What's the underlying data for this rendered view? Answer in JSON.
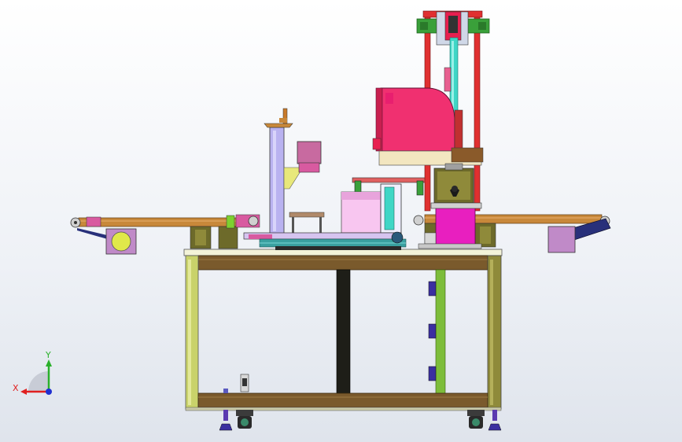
{
  "triad": {
    "x_label": "X",
    "y_label": "Y",
    "x_color": "#e02020",
    "y_color": "#2ab02a",
    "z_color": "#2030d0"
  },
  "palette": {
    "frame_olive": "#c9d26a",
    "frame_dark": "#6d6a2a",
    "wood_beam": "#7a5a2c",
    "tower_red": "#e03030",
    "tower_green": "#3aa03a",
    "cyan_shaft": "#3fd6c6",
    "magenta": "#e81fbf",
    "crimson_head": "#f03070",
    "lavender": "#b9b2f0",
    "conveyor_orange": "#c8883a",
    "belt_blue": "#28307a"
  }
}
